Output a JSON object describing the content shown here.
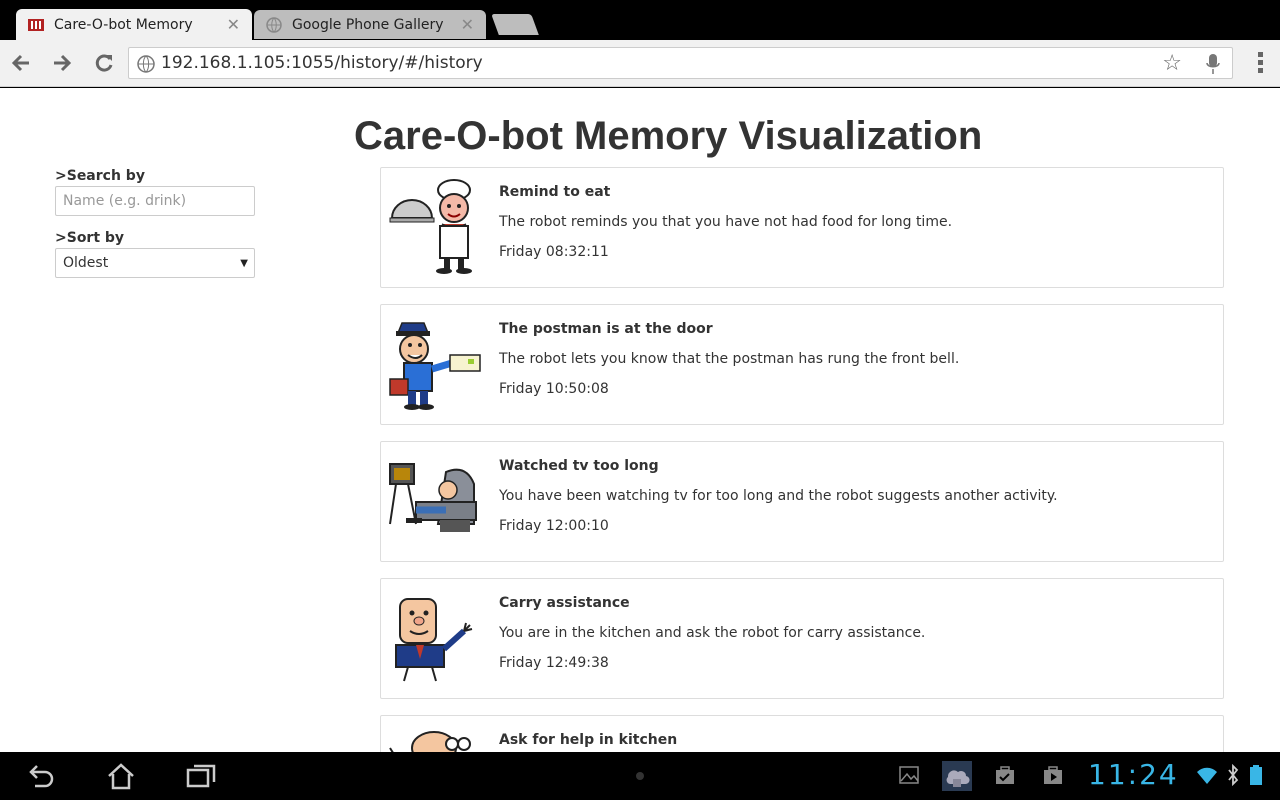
{
  "browser": {
    "tabs": [
      {
        "title": "Care-O-bot Memory",
        "active": true
      },
      {
        "title": "Google Phone Gallery",
        "active": false
      }
    ],
    "url": "192.168.1.105:1055/history/#/history"
  },
  "page": {
    "heading": "Care-O-bot Memory Visualization",
    "search_label": ">Search by",
    "search_placeholder": "Name (e.g. drink)",
    "sort_label": ">Sort by",
    "sort_value": "Oldest"
  },
  "events": [
    {
      "title": "Remind to eat",
      "description": "The robot reminds you that you have not had food for long time.",
      "time": "Friday 08:32:11",
      "icon": "chef-icon"
    },
    {
      "title": "The postman is at the door",
      "description": "The robot lets you know that the postman has rung the front bell.",
      "time": "Friday 10:50:08",
      "icon": "postman-icon"
    },
    {
      "title": "Watched tv too long",
      "description": "You have been watching tv for too long and the robot suggests another activity.",
      "time": "Friday 12:00:10",
      "icon": "tv-watcher-icon"
    },
    {
      "title": "Carry assistance",
      "description": "You are in the kitchen and ask the robot for carry assistance.",
      "time": "Friday 12:49:38",
      "icon": "businessman-icon"
    },
    {
      "title": "Ask for help in kitchen",
      "description": "",
      "time": "",
      "icon": "kitchen-help-icon"
    }
  ],
  "status_bar": {
    "clock": "11:24"
  }
}
